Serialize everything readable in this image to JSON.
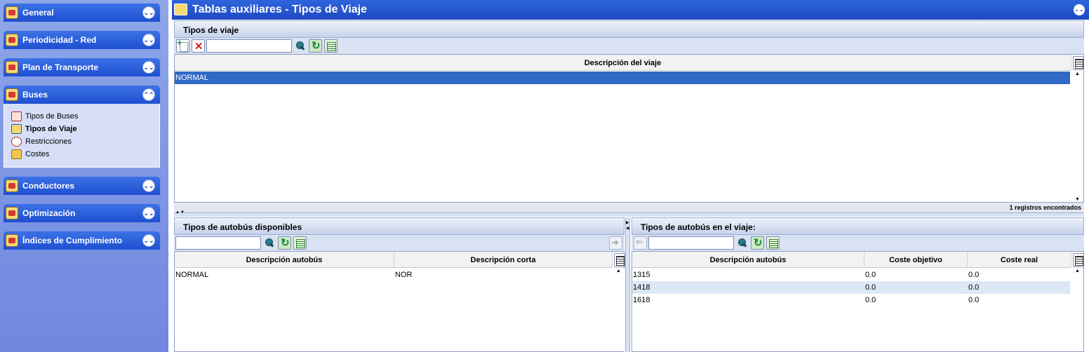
{
  "sidebar": {
    "groups": [
      {
        "label": "General",
        "icon": "bus-house-icon"
      },
      {
        "label": "Periodicidad - Red",
        "icon": "calendar-network-icon"
      },
      {
        "label": "Plan de Transporte",
        "icon": "transport-plan-icon"
      },
      {
        "label": "Buses",
        "icon": "bus-icon",
        "expanded": true
      },
      {
        "label": "Conductores",
        "icon": "driver-icon"
      },
      {
        "label": "Optimización",
        "icon": "optimization-icon"
      },
      {
        "label": "Índices de Cumplimiento",
        "icon": "chart-icon"
      }
    ],
    "buses_items": [
      {
        "label": "Tipos de Buses",
        "icon": "bus-type-icon",
        "active": false
      },
      {
        "label": "Tipos de Viaje",
        "icon": "trip-type-icon",
        "active": true
      },
      {
        "label": "Restricciones",
        "icon": "restriction-icon",
        "active": false
      },
      {
        "label": "Costes",
        "icon": "coins-icon",
        "active": false
      }
    ]
  },
  "window": {
    "title": "Tablas auxiliares - Tipos de Viaje"
  },
  "tipos_viaje": {
    "header": "Tipos de viaje",
    "search_value": "",
    "columns": [
      "Descripción del viaje"
    ],
    "rows": [
      [
        "NORMAL"
      ]
    ],
    "selected_row": 0,
    "footer": "1 registros encontrados"
  },
  "disponibles": {
    "header": "Tipos de autobús disponibles",
    "search_value": "",
    "columns": [
      "Descripción autobús",
      "Descripción corta"
    ],
    "rows": [
      [
        "NORMAL",
        "NOR"
      ]
    ]
  },
  "en_viaje": {
    "header": "Tipos de autobús en el viaje:",
    "search_value": "",
    "columns": [
      "Descripción autobús",
      "Coste objetivo",
      "Coste real"
    ],
    "rows": [
      [
        "1315",
        "0.0",
        "0.0"
      ],
      [
        "1418",
        "0.0",
        "0.0"
      ],
      [
        "1618",
        "0.0",
        "0.0"
      ]
    ],
    "highlighted_row": 1
  },
  "colors": {
    "header_blue": "#2f64dc",
    "selected_row": "#316ac5",
    "sidebar_bg": "#8ea6e8"
  }
}
